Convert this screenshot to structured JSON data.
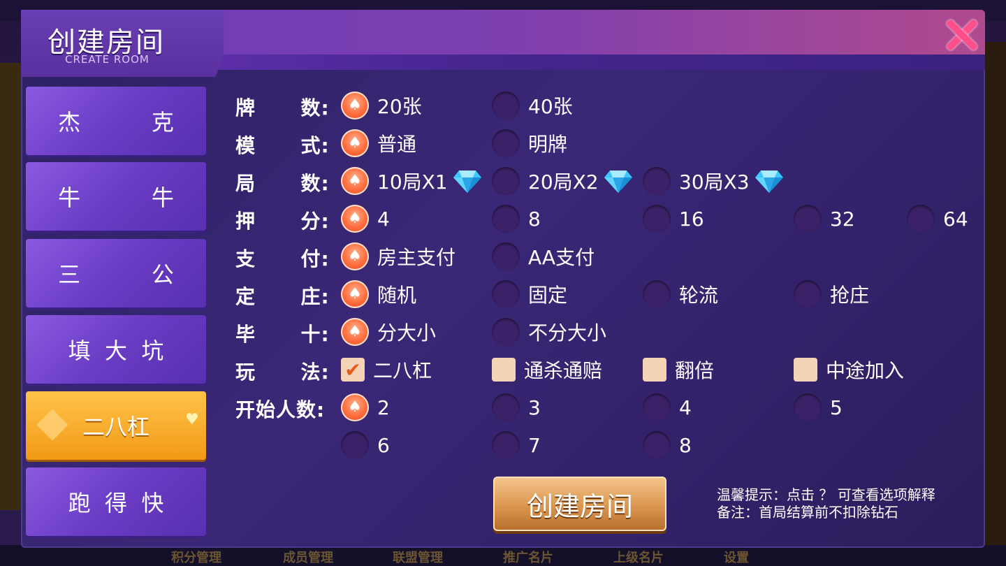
{
  "background": {
    "bottom_items": [
      "积分管理",
      "成员管理",
      "联盟管理",
      "推广名片",
      "上级名片",
      "设置"
    ]
  },
  "dialog": {
    "title": "创建房间",
    "subtitle": "CREATE ROOM"
  },
  "sidebar": {
    "items": [
      {
        "label": "杰          克",
        "active": false
      },
      {
        "label": "牛          牛",
        "active": false
      },
      {
        "label": "三          公",
        "active": false
      },
      {
        "label": "填  大  坑",
        "active": false
      },
      {
        "label": "二八杠",
        "active": true
      },
      {
        "label": "跑  得  快",
        "active": false
      }
    ]
  },
  "form": {
    "rows": [
      {
        "label": "牌      数:",
        "options": [
          {
            "text": "20张",
            "selected": true
          },
          {
            "text": "40张",
            "selected": false
          }
        ]
      },
      {
        "label": "模      式:",
        "options": [
          {
            "text": "普通",
            "selected": true
          },
          {
            "text": "明牌",
            "selected": false
          }
        ]
      },
      {
        "label": "局      数:",
        "options": [
          {
            "text": "10局X1",
            "selected": true,
            "gem": true
          },
          {
            "text": "20局X2",
            "selected": false,
            "gem": true
          },
          {
            "text": "30局X3",
            "selected": false,
            "gem": true
          }
        ]
      },
      {
        "label": "押      分:",
        "options": [
          {
            "text": "4",
            "selected": true
          },
          {
            "text": "8",
            "selected": false
          },
          {
            "text": "16",
            "selected": false
          },
          {
            "text": "32",
            "selected": false
          },
          {
            "text": "64",
            "selected": false
          }
        ]
      },
      {
        "label": "支      付:",
        "options": [
          {
            "text": "房主支付",
            "selected": true
          },
          {
            "text": "AA支付",
            "selected": false
          }
        ]
      },
      {
        "label": "定      庄:",
        "options": [
          {
            "text": "随机",
            "selected": true
          },
          {
            "text": "固定",
            "selected": false
          },
          {
            "text": "轮流",
            "selected": false
          },
          {
            "text": "抢庄",
            "selected": false
          }
        ]
      },
      {
        "label": "毕      十:",
        "options": [
          {
            "text": "分大小",
            "selected": true
          },
          {
            "text": "不分大小",
            "selected": false
          }
        ]
      },
      {
        "label": "玩      法:",
        "options": [
          {
            "text": "二八杠",
            "checked": true
          },
          {
            "text": "通杀通赔",
            "checked": false
          },
          {
            "text": "翻倍",
            "checked": false
          },
          {
            "text": "中途加入",
            "checked": false
          }
        ]
      },
      {
        "label": "开始人数:",
        "options": [
          {
            "text": "2",
            "selected": true
          },
          {
            "text": "3",
            "selected": false
          },
          {
            "text": "4",
            "selected": false
          },
          {
            "text": "5",
            "selected": false
          },
          {
            "text": "6",
            "selected": false
          },
          {
            "text": "7",
            "selected": false
          },
          {
            "text": "8",
            "selected": false
          }
        ]
      }
    ]
  },
  "create_button": "创建房间",
  "tips": {
    "line1": "温馨提示：点击 ？  可查看选项解释",
    "line2": "备注：首局结算前不扣除钻石"
  },
  "icons": {
    "close": "close-icon",
    "radio_selected": "spade-icon",
    "gem": "diamond-gem-icon",
    "checkbox_checked": "check-icon"
  },
  "colors": {
    "accent_orange": "#ff6a3c",
    "dialog_bg": "#2e2163",
    "active_tab": "#f29a16",
    "close": "#ff4f8a"
  }
}
